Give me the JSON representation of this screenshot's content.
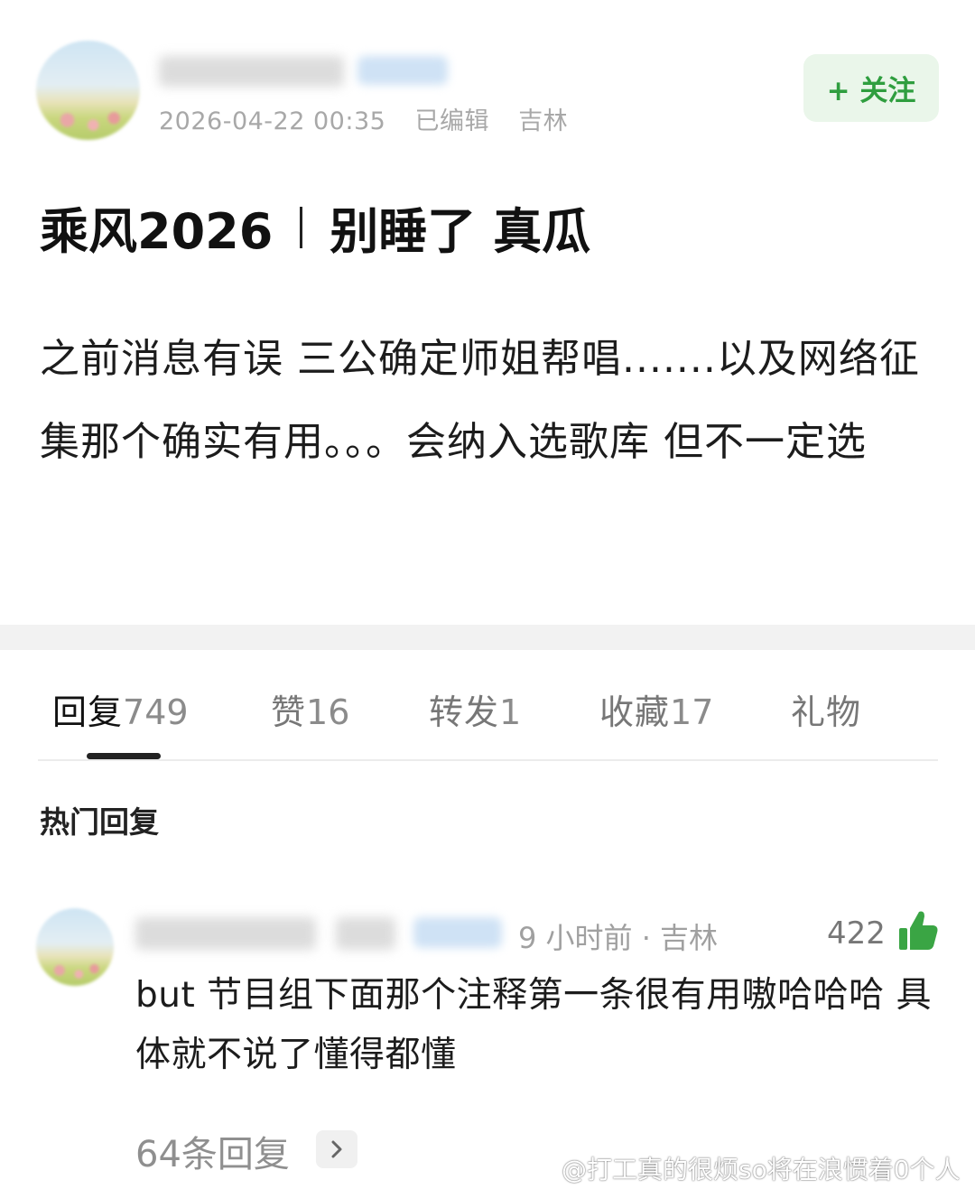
{
  "post": {
    "timestamp": "2026-04-22 00:35",
    "edited": "已编辑",
    "location": "吉林",
    "follow_label": "+ 关注",
    "title_left": "乘风2026",
    "title_right": "别睡了 真瓜",
    "body": "之前消息有误 三公确定师姐帮唱.......以及网络征集那个确实有用。。。会纳入选歌库 但不一定选"
  },
  "tabs": [
    {
      "label": "回复",
      "count": "749"
    },
    {
      "label": "赞",
      "count": "16"
    },
    {
      "label": "转发",
      "count": "1"
    },
    {
      "label": "收藏",
      "count": "17"
    },
    {
      "label": "礼物",
      "count": ""
    }
  ],
  "section_title": "热门回复",
  "comment": {
    "meta": "9 小时前 · 吉林",
    "likes": "422",
    "text": "but 节目组下面那个注释第一条很有用嗷哈哈哈 具体就不说了懂得都懂",
    "replies": "64条回复"
  },
  "watermark": "@打工真的很烦so将在浪惯着0个人",
  "colors": {
    "accent_green": "#2f9e3f",
    "follow_bg": "#eaf6ea",
    "meta_gray": "#a8a8a8"
  },
  "icons": {
    "thumb": "thumbs-up-icon",
    "chevron": "chevron-right-icon",
    "weibo": "weibo-logo-icon"
  }
}
